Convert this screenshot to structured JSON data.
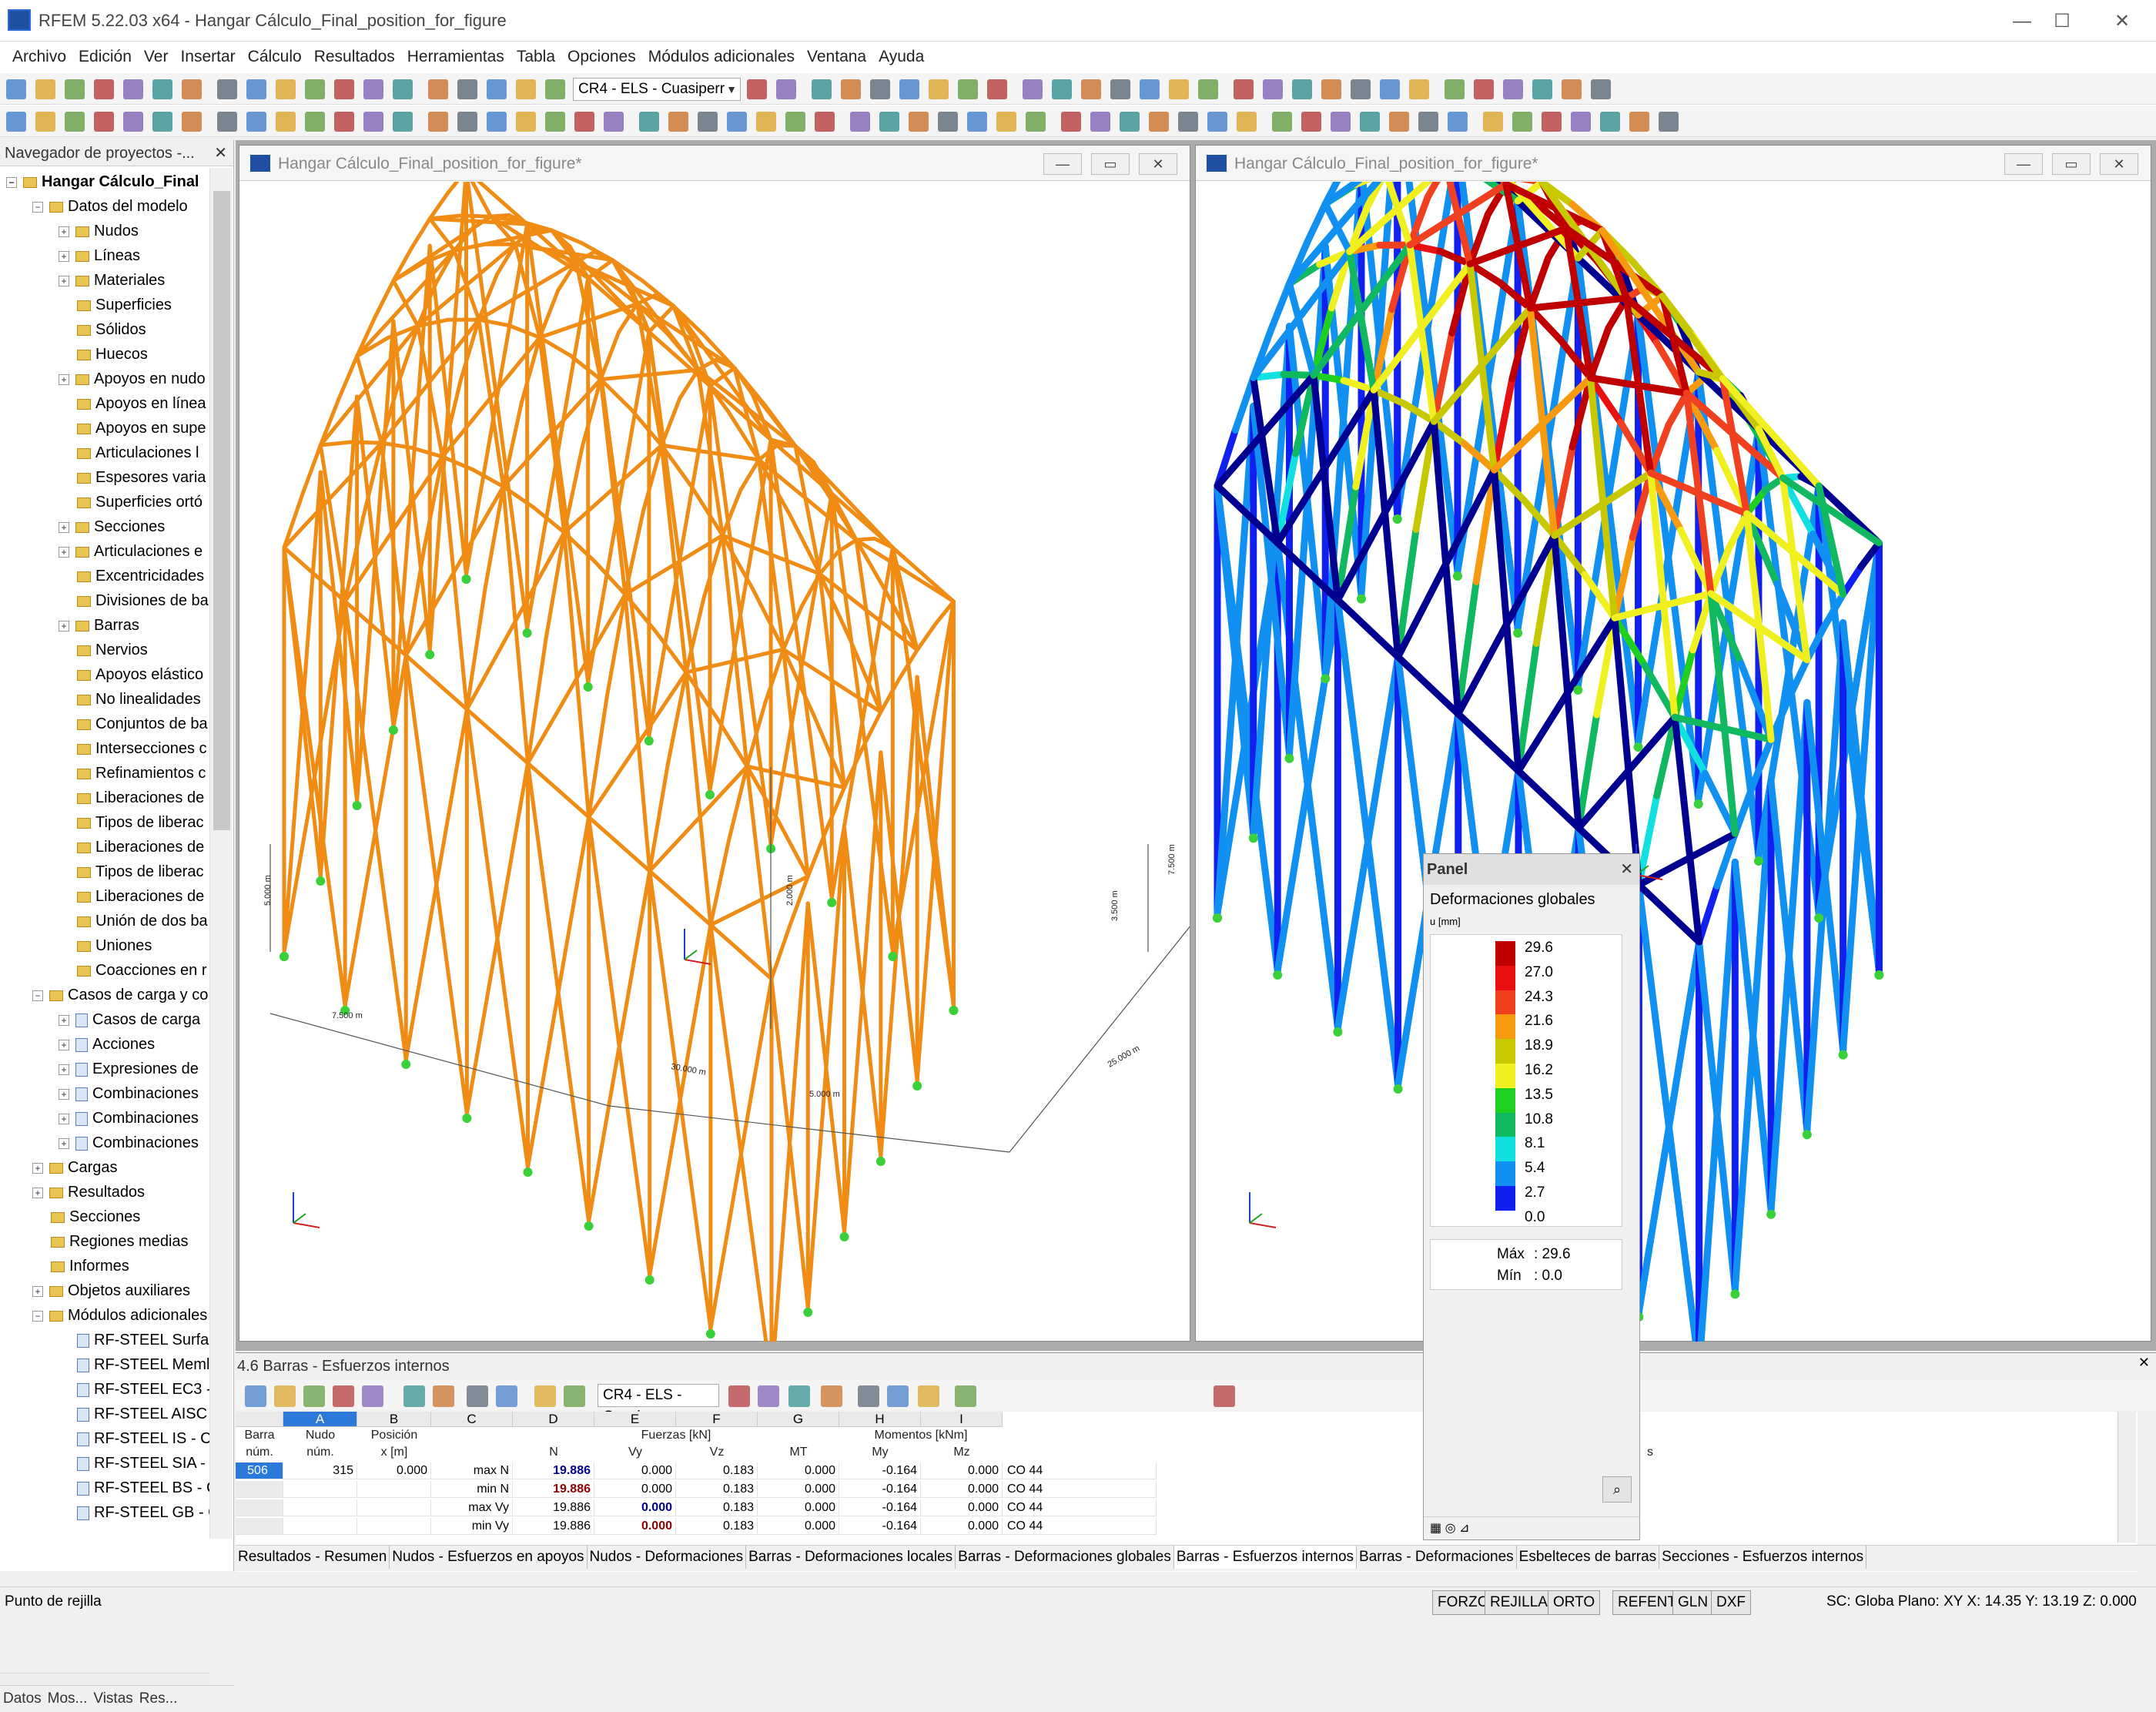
{
  "window": {
    "title": "RFEM 5.22.03 x64 - Hangar Cálculo_Final_position_for_figure",
    "minimize": "—",
    "maximize": "☐",
    "close": "✕"
  },
  "menu": [
    "Archivo",
    "Edición",
    "Ver",
    "Insertar",
    "Cálculo",
    "Resultados",
    "Herramientas",
    "Tabla",
    "Opciones",
    "Módulos adicionales",
    "Ventana",
    "Ayuda"
  ],
  "toolbar": {
    "load_combo": "CR4 - ELS - Cuasiperr"
  },
  "navigator": {
    "title": "Navegador de proyectos -...",
    "items": [
      {
        "label": "Hangar Cálculo_Final",
        "indent": 0,
        "type": "root",
        "exp": "-"
      },
      {
        "label": "Datos del modelo",
        "indent": 1,
        "type": "folder",
        "exp": "-"
      },
      {
        "label": "Nudos",
        "indent": 2,
        "type": "folder",
        "exp": "+"
      },
      {
        "label": "Líneas",
        "indent": 2,
        "type": "folder",
        "exp": "+"
      },
      {
        "label": "Materiales",
        "indent": 2,
        "type": "folder",
        "exp": "+"
      },
      {
        "label": "Superficies",
        "indent": 2,
        "type": "folder",
        "exp": ""
      },
      {
        "label": "Sólidos",
        "indent": 2,
        "type": "folder",
        "exp": ""
      },
      {
        "label": "Huecos",
        "indent": 2,
        "type": "folder",
        "exp": ""
      },
      {
        "label": "Apoyos en nudo",
        "indent": 2,
        "type": "folder",
        "exp": "+"
      },
      {
        "label": "Apoyos en línea",
        "indent": 2,
        "type": "folder",
        "exp": ""
      },
      {
        "label": "Apoyos en supe",
        "indent": 2,
        "type": "folder",
        "exp": ""
      },
      {
        "label": "Articulaciones l",
        "indent": 2,
        "type": "folder",
        "exp": ""
      },
      {
        "label": "Espesores varia",
        "indent": 2,
        "type": "folder",
        "exp": ""
      },
      {
        "label": "Superficies ortó",
        "indent": 2,
        "type": "folder",
        "exp": ""
      },
      {
        "label": "Secciones",
        "indent": 2,
        "type": "folder",
        "exp": "+"
      },
      {
        "label": "Articulaciones e",
        "indent": 2,
        "type": "folder",
        "exp": "+"
      },
      {
        "label": "Excentricidades",
        "indent": 2,
        "type": "folder",
        "exp": ""
      },
      {
        "label": "Divisiones de ba",
        "indent": 2,
        "type": "folder",
        "exp": ""
      },
      {
        "label": "Barras",
        "indent": 2,
        "type": "folder",
        "exp": "+"
      },
      {
        "label": "Nervios",
        "indent": 2,
        "type": "folder",
        "exp": ""
      },
      {
        "label": "Apoyos elástico",
        "indent": 2,
        "type": "folder",
        "exp": ""
      },
      {
        "label": "No linealidades",
        "indent": 2,
        "type": "folder",
        "exp": ""
      },
      {
        "label": "Conjuntos de ba",
        "indent": 2,
        "type": "folder",
        "exp": ""
      },
      {
        "label": "Intersecciones c",
        "indent": 2,
        "type": "folder",
        "exp": ""
      },
      {
        "label": "Refinamientos c",
        "indent": 2,
        "type": "folder",
        "exp": ""
      },
      {
        "label": "Liberaciones de",
        "indent": 2,
        "type": "folder",
        "exp": ""
      },
      {
        "label": "Tipos de liberac",
        "indent": 2,
        "type": "folder",
        "exp": ""
      },
      {
        "label": "Liberaciones de",
        "indent": 2,
        "type": "folder",
        "exp": ""
      },
      {
        "label": "Tipos de liberac",
        "indent": 2,
        "type": "folder",
        "exp": ""
      },
      {
        "label": "Liberaciones de",
        "indent": 2,
        "type": "folder",
        "exp": ""
      },
      {
        "label": "Unión de dos ba",
        "indent": 2,
        "type": "folder",
        "exp": ""
      },
      {
        "label": "Uniones",
        "indent": 2,
        "type": "folder",
        "exp": ""
      },
      {
        "label": "Coacciones en r",
        "indent": 2,
        "type": "folder",
        "exp": ""
      },
      {
        "label": "Casos de carga y co",
        "indent": 1,
        "type": "folder",
        "exp": "-"
      },
      {
        "label": "Casos de carga",
        "indent": 2,
        "type": "doc",
        "exp": "+"
      },
      {
        "label": "Acciones",
        "indent": 2,
        "type": "doc",
        "exp": "+"
      },
      {
        "label": "Expresiones de",
        "indent": 2,
        "type": "doc",
        "exp": "+"
      },
      {
        "label": "Combinaciones",
        "indent": 2,
        "type": "doc",
        "exp": "+"
      },
      {
        "label": "Combinaciones",
        "indent": 2,
        "type": "doc",
        "exp": "+"
      },
      {
        "label": "Combinaciones",
        "indent": 2,
        "type": "doc",
        "exp": "+"
      },
      {
        "label": "Cargas",
        "indent": 1,
        "type": "folder",
        "exp": "+"
      },
      {
        "label": "Resultados",
        "indent": 1,
        "type": "folder",
        "exp": "+"
      },
      {
        "label": "Secciones",
        "indent": 1,
        "type": "folder",
        "exp": ""
      },
      {
        "label": "Regiones medias",
        "indent": 1,
        "type": "folder",
        "exp": ""
      },
      {
        "label": "Informes",
        "indent": 1,
        "type": "folder",
        "exp": ""
      },
      {
        "label": "Objetos auxiliares",
        "indent": 1,
        "type": "folder",
        "exp": "+"
      },
      {
        "label": "Módulos adicionales",
        "indent": 1,
        "type": "folder",
        "exp": "-"
      },
      {
        "label": "RF-STEEL Surfac",
        "indent": 2,
        "type": "doc",
        "exp": ""
      },
      {
        "label": "RF-STEEL Meml",
        "indent": 2,
        "type": "doc",
        "exp": ""
      },
      {
        "label": "RF-STEEL EC3 -",
        "indent": 2,
        "type": "doc",
        "exp": ""
      },
      {
        "label": "RF-STEEL AISC",
        "indent": 2,
        "type": "doc",
        "exp": ""
      },
      {
        "label": "RF-STEEL IS - Ca",
        "indent": 2,
        "type": "doc",
        "exp": ""
      },
      {
        "label": "RF-STEEL SIA -",
        "indent": 2,
        "type": "doc",
        "exp": ""
      },
      {
        "label": "RF-STEEL BS - C",
        "indent": 2,
        "type": "doc",
        "exp": ""
      },
      {
        "label": "RF-STEEL GB - C",
        "indent": 2,
        "type": "doc",
        "exp": ""
      }
    ],
    "bottom_tabs": [
      "Datos",
      "Mos...",
      "Vistas",
      "Res..."
    ]
  },
  "view_left": {
    "title": "Hangar Cálculo_Final_position_for_figure*",
    "dims": [
      "7.500 m",
      "5.000 m",
      "30.000 m",
      "2.000 m",
      "3.500 m",
      "7.500 m",
      "25.000 m",
      "5.000 m"
    ]
  },
  "view_right": {
    "title": "Hangar Cálculo_Final_position_for_figure*"
  },
  "panel": {
    "title": "Panel",
    "subtitle": "Deformaciones globales",
    "unit": "u [mm]",
    "levels": [
      "29.6",
      "27.0",
      "24.3",
      "21.6",
      "18.9",
      "16.2",
      "13.5",
      "10.8",
      "8.1",
      "5.4",
      "2.7",
      "0.0"
    ],
    "colors": [
      "#c00000",
      "#e81010",
      "#f04020",
      "#f89a10",
      "#c8c800",
      "#f0f020",
      "#20d020",
      "#10b860",
      "#10e0e0",
      "#1090f0",
      "#1020f0",
      "#000090"
    ],
    "max_label": "Máx",
    "max_value": ": 29.6",
    "min_label": "Mín",
    "min_value": ":  0.0"
  },
  "results": {
    "title": "4.6 Barras - Esfuerzos internos",
    "combo": "CR4 - ELS - Cuasip",
    "col_letters": [
      "A",
      "B",
      "C",
      "D",
      "E",
      "F",
      "G",
      "H",
      "I"
    ],
    "groups": {
      "forces": "Fuerzas [kN]",
      "moments": "Momentos [kNm]"
    },
    "subheads": {
      "barra": "Barra",
      "barra_num": "núm.",
      "nudo": "Nudo",
      "nudo_num": "núm.",
      "pos": "Posición",
      "pos_unit": "x [m]",
      "n": "N",
      "vy": "Vy",
      "vz": "Vz",
      "mt": "MT",
      "my": "My",
      "mz": "Mz"
    },
    "rows": [
      {
        "barra": "506",
        "nudo": "315",
        "pos": "0.000",
        "type": "max N",
        "n": "19.886",
        "vy": "0.000",
        "vz": "0.183",
        "mt": "0.000",
        "my": "-0.164",
        "mz": "0.000",
        "co": "CO 44"
      },
      {
        "barra": "",
        "nudo": "",
        "pos": "",
        "type": "min N",
        "n": "19.886",
        "vy": "0.000",
        "vz": "0.183",
        "mt": "0.000",
        "my": "-0.164",
        "mz": "0.000",
        "co": "CO 44"
      },
      {
        "barra": "",
        "nudo": "",
        "pos": "",
        "type": "max Vy",
        "n": "19.886",
        "vy": "0.000",
        "vz": "0.183",
        "mt": "0.000",
        "my": "-0.164",
        "mz": "0.000",
        "co": "CO 44"
      },
      {
        "barra": "",
        "nudo": "",
        "pos": "",
        "type": "min Vy",
        "n": "19.886",
        "vy": "0.000",
        "vz": "0.183",
        "mt": "0.000",
        "my": "-0.164",
        "mz": "0.000",
        "co": "CO 44"
      }
    ],
    "right_letter": "s",
    "tabs": [
      "Resultados - Resumen",
      "Nudos - Esfuerzos en apoyos",
      "Nudos - Deformaciones",
      "Barras - Deformaciones locales",
      "Barras - Deformaciones globales",
      "Barras - Esfuerzos internos",
      "Barras - Deformaciones",
      "Esbelteces de barras",
      "Secciones - Esfuerzos internos"
    ]
  },
  "status": {
    "text": "Punto de rejilla",
    "buttons": [
      "FORZC",
      "REJILLA",
      "ORTO",
      "REFENT",
      "GLN",
      "DXF"
    ],
    "coords": "SC: Globa Plano: XY X:  14.35 Y:  13.19 Z:  0.000"
  }
}
